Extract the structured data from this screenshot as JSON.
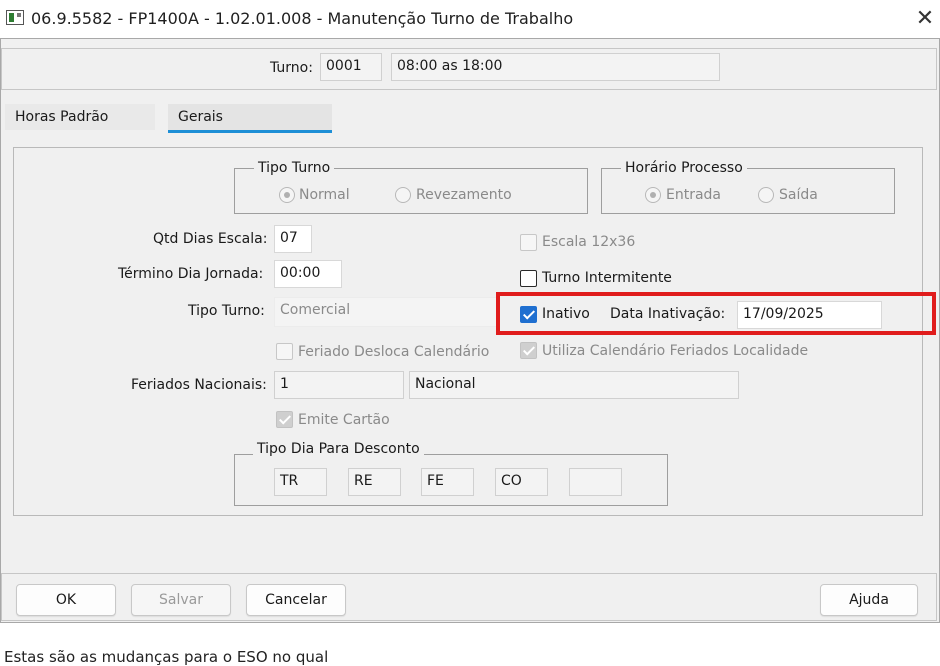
{
  "window": {
    "title": "06.9.5582 - FP1400A - 1.02.01.008 - Manutenção Turno de Trabalho",
    "close_glyph": "✕"
  },
  "header": {
    "turno_label": "Turno:",
    "turno_code": "0001",
    "turno_desc": "08:00 as 18:00"
  },
  "tabs": [
    {
      "label": "Horas Padrão",
      "active": false
    },
    {
      "label": "Gerais",
      "active": true
    }
  ],
  "tipo_turno_group": {
    "title": "Tipo Turno",
    "options": [
      {
        "label": "Normal",
        "checked": true
      },
      {
        "label": "Revezamento",
        "checked": false
      }
    ]
  },
  "horario_processo_group": {
    "title": "Horário Processo",
    "options": [
      {
        "label": "Entrada",
        "checked": true
      },
      {
        "label": "Saída",
        "checked": false
      }
    ]
  },
  "form": {
    "qtd_dias_escala_label": "Qtd Dias Escala:",
    "qtd_dias_escala_value": "07",
    "termino_dia_jornada_label": "Término Dia Jornada:",
    "termino_dia_jornada_value": "00:00",
    "tipo_turno_label": "Tipo Turno:",
    "tipo_turno_value": "Comercial",
    "feriados_nacionais_label": "Feriados Nacionais:",
    "feriados_nacionais_code": "1",
    "feriados_nacionais_desc": "Nacional"
  },
  "checkboxes": {
    "escala_12x36": {
      "label": "Escala 12x36",
      "checked": false,
      "enabled": false
    },
    "turno_intermitente": {
      "label": "Turno Intermitente",
      "checked": false,
      "enabled": true
    },
    "inativo": {
      "label": "Inativo",
      "checked": true,
      "enabled": true
    },
    "feriado_desloca": {
      "label": "Feriado Desloca Calendário",
      "checked": false,
      "enabled": false
    },
    "utiliza_calendario": {
      "label": "Utiliza Calendário Feriados Localidade",
      "checked": true,
      "enabled": false
    },
    "emite_cartao": {
      "label": "Emite Cartão",
      "checked": true,
      "enabled": false
    }
  },
  "data_inativacao": {
    "label": "Data Inativação:",
    "value": "17/09/2025"
  },
  "tipo_dia_desconto": {
    "title": "Tipo Dia Para Desconto",
    "values": [
      "TR",
      "RE",
      "FE",
      "CO",
      ""
    ]
  },
  "buttons": {
    "ok": "OK",
    "salvar": "Salvar",
    "cancelar": "Cancelar",
    "ajuda": "Ajuda"
  },
  "footer_text": "Estas são as mudanças para o ESO no qual",
  "colors": {
    "highlight": "#e01c1c",
    "tab_accent": "#1e8fd6",
    "checkbox_checked": "#1f6fd0"
  }
}
